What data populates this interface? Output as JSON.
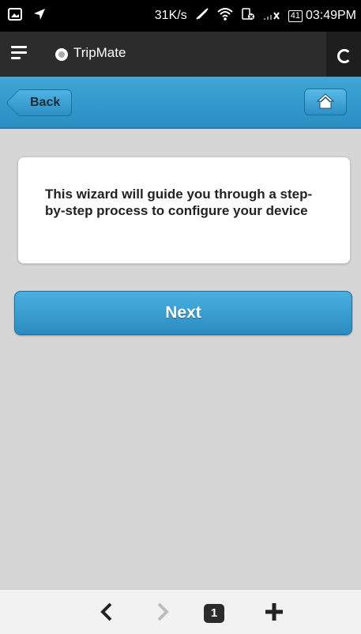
{
  "status_bar": {
    "net_speed": "31K/s",
    "battery": "41",
    "time": "03:49PM"
  },
  "browser": {
    "site_title": "TripMate",
    "tab_count": "1"
  },
  "header": {
    "back_label": "Back"
  },
  "main": {
    "description": "This wizard will guide you through a step-by-step process to configure your device",
    "next_label": "Next"
  },
  "colors": {
    "header_blue": "#3fa6d7",
    "button_blue": "#2b8bc0",
    "page_background": "#d6d6d6"
  }
}
